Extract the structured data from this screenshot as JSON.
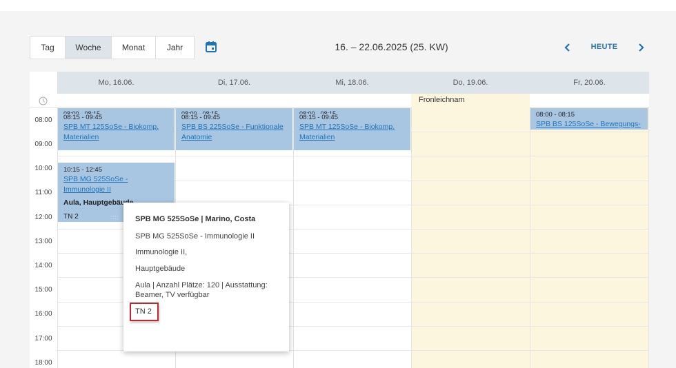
{
  "toolbar": {
    "views": [
      {
        "label": "Tag",
        "active": false
      },
      {
        "label": "Woche",
        "active": true
      },
      {
        "label": "Monat",
        "active": false
      },
      {
        "label": "Jahr",
        "active": false
      }
    ],
    "calendar_icon": "calendar-picker-icon",
    "range_title": "16. – 22.06.2025 (25. KW)",
    "prev_icon": "chevron-left-icon",
    "today_label": "HEUTE",
    "next_icon": "chevron-right-icon"
  },
  "calendar": {
    "clock_icon": "clock-icon",
    "days": [
      "Mo, 16.06.",
      "Di, 17.06.",
      "Mi, 18.06.",
      "Do, 19.06.",
      "Fr, 20.06."
    ],
    "holiday_label": "Fronleichnam",
    "hours": [
      "08:00",
      "09:00",
      "10:00",
      "11:00",
      "12:00",
      "13:00",
      "14:00",
      "15:00",
      "16:00",
      "17:00",
      "18:00"
    ],
    "events": {
      "mon_morning": {
        "time_top": "08:00 - 08:15",
        "time": "08:15 - 09:45",
        "title": "SPB MT 125SoSe - Biokomp. Materialien"
      },
      "tue_morning": {
        "time_top": "08:00 - 08:15",
        "time": "08:15 - 09:45",
        "title": "SPB BS 225SoSe - Funktionale Anatomie"
      },
      "wed_morning": {
        "time_top": "08:00 - 08:15",
        "time": "08:15 - 09:45",
        "title": "SPB MT 125SoSe - Biokomp. Materialien"
      },
      "fri_morning": {
        "time": "08:00 - 08:15",
        "title": "SPB BS 125SoSe - Bewegungs-"
      },
      "mon_late": {
        "time": "10:15 - 12:45",
        "title": "SPB MG 525SoSe - Immunologie II",
        "room": "Aula, Hauptgebäude",
        "tn": "TN 2",
        "grip": "::::"
      }
    }
  },
  "popup": {
    "title": "SPB MG 525SoSe | Marino, Costa",
    "course": "SPB MG 525SoSe - Immunologie II",
    "line2": "Immunologie II,",
    "line3": "Hauptgebäude",
    "room_info": "Aula | Anzahl Plätze: 120 | Ausstattung: Beamer, TV verfügbar",
    "tn": "TN 2"
  },
  "colors": {
    "accent": "#1f73b7",
    "event_bg": "#a8c6e2",
    "holiday_bg": "#fcf6df",
    "header_bg": "#dde5ea",
    "highlight_border": "#c0272d"
  }
}
